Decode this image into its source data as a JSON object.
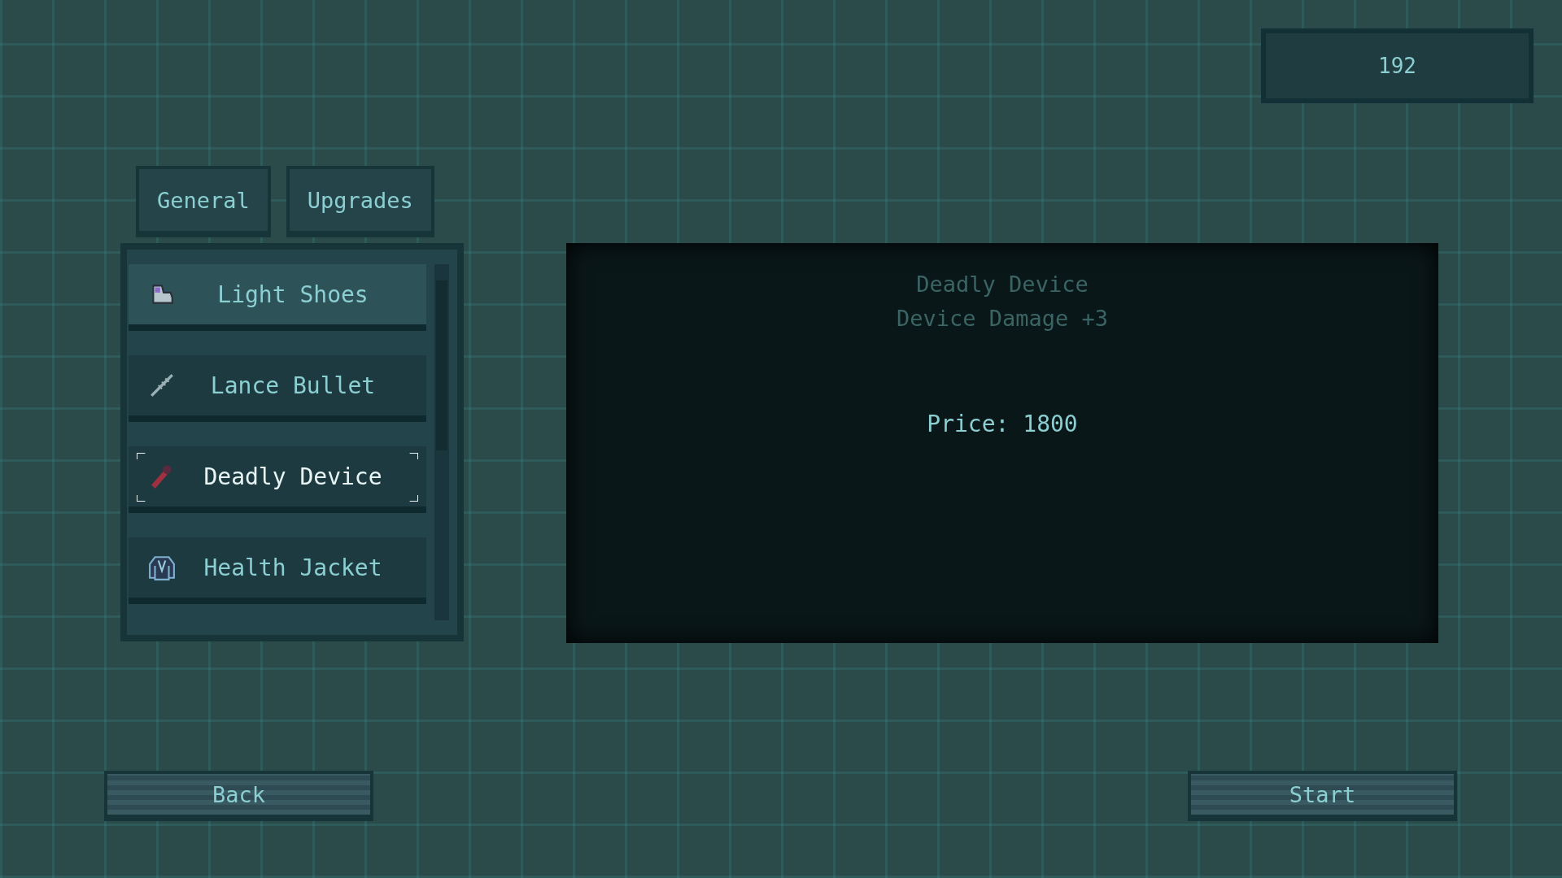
{
  "currency": {
    "amount": "192"
  },
  "tabs": [
    {
      "label": "General"
    },
    {
      "label": "Upgrades"
    }
  ],
  "items": [
    {
      "name": "Light Shoes",
      "hovered": true,
      "selected": false
    },
    {
      "name": "Lance Bullet",
      "hovered": false,
      "selected": false
    },
    {
      "name": "Deadly Device",
      "hovered": false,
      "selected": true
    },
    {
      "name": "Health Jacket",
      "hovered": false,
      "selected": false
    }
  ],
  "detail": {
    "title": "Deadly Device",
    "effect": "Device Damage +3",
    "price": "Price: 1800"
  },
  "buttons": [
    {
      "label": "Back"
    },
    {
      "label": "Start"
    }
  ]
}
